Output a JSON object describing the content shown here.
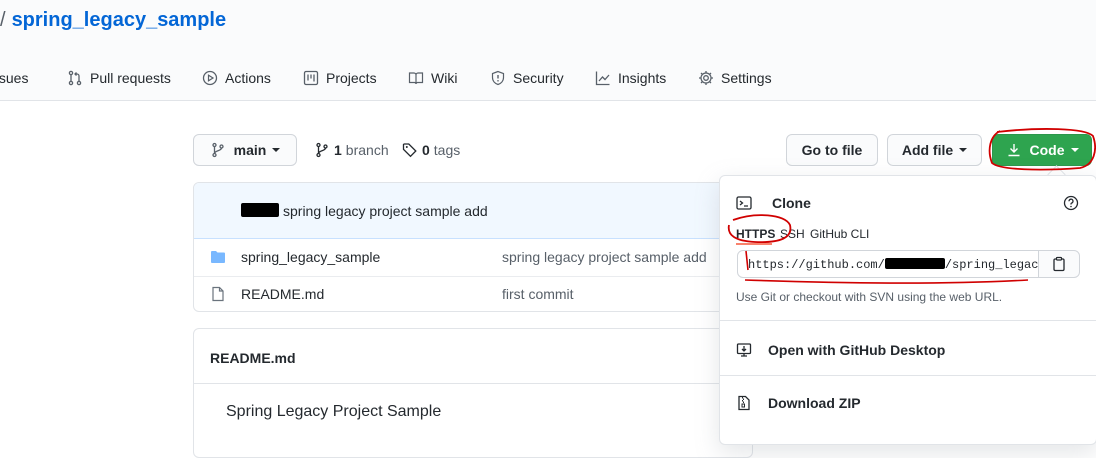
{
  "header": {
    "separator": "/",
    "repo_name": "spring_legacy_sample",
    "tabs": [
      {
        "label": "Issues",
        "icon": "issue-icon"
      },
      {
        "label": "Pull requests",
        "icon": "pull-request-icon"
      },
      {
        "label": "Actions",
        "icon": "play-icon"
      },
      {
        "label": "Projects",
        "icon": "project-icon"
      },
      {
        "label": "Wiki",
        "icon": "book-icon"
      },
      {
        "label": "Security",
        "icon": "shield-icon"
      },
      {
        "label": "Insights",
        "icon": "graph-icon"
      },
      {
        "label": "Settings",
        "icon": "gear-icon"
      }
    ]
  },
  "toolbar": {
    "branch": "main",
    "branch_count": "1",
    "branch_word": "branch",
    "tag_count": "0",
    "tag_word": "tags",
    "go_to_file": "Go to file",
    "add_file": "Add file",
    "code": "Code"
  },
  "files": {
    "latest_commit": "spring legacy project sample add",
    "rows": [
      {
        "name": "spring_legacy_sample",
        "type": "folder",
        "message": "spring legacy project sample add"
      },
      {
        "name": "README.md",
        "type": "file",
        "message": "first commit"
      }
    ]
  },
  "readme": {
    "filename": "README.md",
    "heading": "Spring Legacy Project Sample"
  },
  "clone_menu": {
    "title": "Clone",
    "protocols": [
      "HTTPS",
      "SSH",
      "GitHub CLI"
    ],
    "selected_protocol": "HTTPS",
    "url_prefix": "https://github.com/",
    "url_suffix": "/spring_legacy",
    "hint": "Use Git or checkout with SVN using the web URL.",
    "open_desktop": "Open with GitHub Desktop",
    "download_zip": "Download ZIP"
  },
  "colors": {
    "link": "#0366d6",
    "primary_button": "#2ea44f",
    "annotation": "#d00000"
  }
}
